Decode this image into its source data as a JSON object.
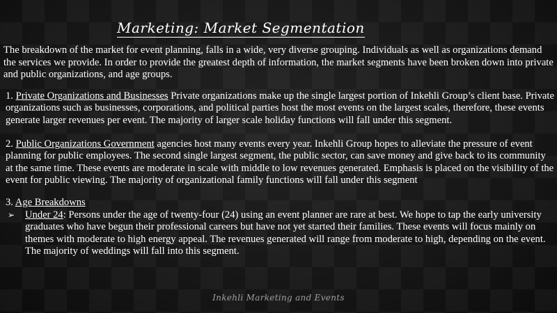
{
  "title": "Marketing: Market Segmentation",
  "intro": "The breakdown of the market for event planning, falls in a wide, very diverse grouping. Individuals as well as organizations demand the services we provide. In order to provide the greatest depth of information, the market segments have been broken down into private and public organizations, and age groups.",
  "section1": {
    "number": "1.",
    "heading": "Private Organizations and Businesses",
    "text": "Private organizations make up the single largest portion of Inkehli Group’s client base. Private organizations such as businesses, corporations, and political parties host the most events on the largest scales, therefore, these events generate larger revenues per event. The majority of larger scale holiday functions will fall under this segment."
  },
  "section2": {
    "number": "2.",
    "heading": "Public Organizations Government",
    "text": "agencies host many events every year. Inkehli Group hopes to alleviate the pressure of event planning for public employees. The second single largest segment, the public sector, can save money and give back to its community at the same time. These events are moderate in scale with middle to low revenues generated. Emphasis is placed on the visibility of the event for public viewing. The majority of organizational family functions will fall under this segment"
  },
  "section3": {
    "number": "3.",
    "heading": "Age Breakdowns",
    "bullet": {
      "label": "Under 24",
      "text": ": Persons under the age of twenty-four (24) using an event planner are rare at best. We hope to tap the early university graduates who have begun their professional careers but have not yet started their families. These events will focus mainly on themes with moderate to high energy appeal. The revenues generated will range from moderate to high, depending on the event. The majority of weddings will fall into this segment."
    }
  },
  "footer": "Inkehli Marketing and Events"
}
